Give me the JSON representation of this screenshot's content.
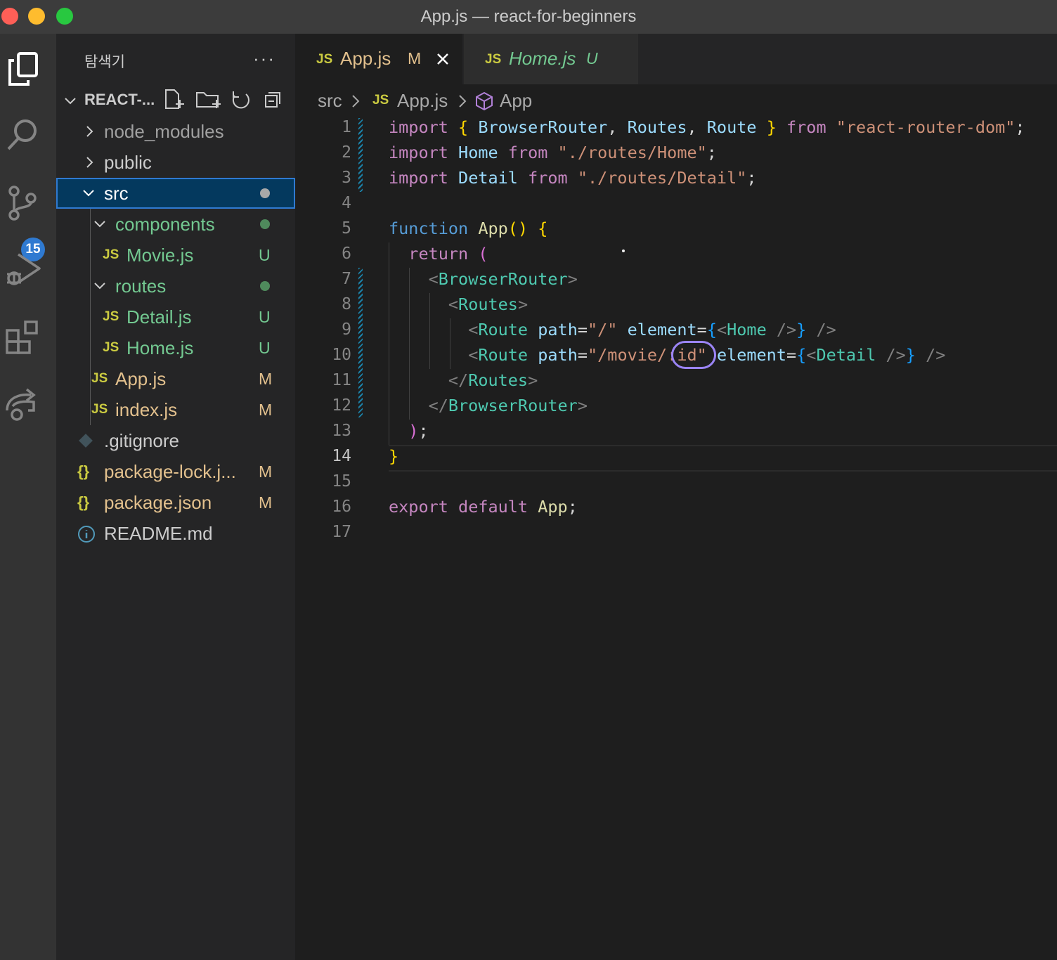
{
  "window": {
    "title": "App.js — react-for-beginners"
  },
  "activity_bar": {
    "source_control_badge": "15"
  },
  "sidebar": {
    "title": "탐색기",
    "more": "···",
    "project": "REACT-...",
    "tree": [
      {
        "label": "node_modules",
        "status": ""
      },
      {
        "label": "public",
        "status": ""
      },
      {
        "label": "src",
        "status": ""
      },
      {
        "label": "components",
        "status": ""
      },
      {
        "label": "Movie.js",
        "status": "U"
      },
      {
        "label": "routes",
        "status": ""
      },
      {
        "label": "Detail.js",
        "status": "U"
      },
      {
        "label": "Home.js",
        "status": "U"
      },
      {
        "label": "App.js",
        "status": "M"
      },
      {
        "label": "index.js",
        "status": "M"
      },
      {
        "label": ".gitignore",
        "status": ""
      },
      {
        "label": "package-lock.j...",
        "status": "M"
      },
      {
        "label": "package.json",
        "status": "M"
      },
      {
        "label": "README.md",
        "status": ""
      }
    ]
  },
  "tabs": [
    {
      "icon": "JS",
      "label": "App.js",
      "status": "M"
    },
    {
      "icon": "JS",
      "label": "Home.js",
      "status": "U"
    }
  ],
  "breadcrumb": {
    "folder": "src",
    "file_icon": "JS",
    "file": "App.js",
    "symbol": "App"
  },
  "editor": {
    "line_numbers": [
      "1",
      "2",
      "3",
      "4",
      "5",
      "6",
      "7",
      "8",
      "9",
      "10",
      "11",
      "12",
      "13",
      "14",
      "15",
      "16",
      "17"
    ],
    "current_line": "14",
    "tokens": {
      "import": "import",
      "from": "from",
      "function": "function",
      "return": "return",
      "export": "export",
      "default": "default",
      "browser_router": "BrowserRouter",
      "routes": "Routes",
      "route": "Route",
      "home": "Home",
      "detail": "Detail",
      "app": "App",
      "path_attr": "path",
      "element_attr": "element",
      "str_rrd": "\"react-router-dom\"",
      "str_home": "\"./routes/Home\"",
      "str_detail": "\"./routes/Detail\"",
      "str_root": "\"/\"",
      "str_movie": "\"/movie/:id\""
    }
  }
}
